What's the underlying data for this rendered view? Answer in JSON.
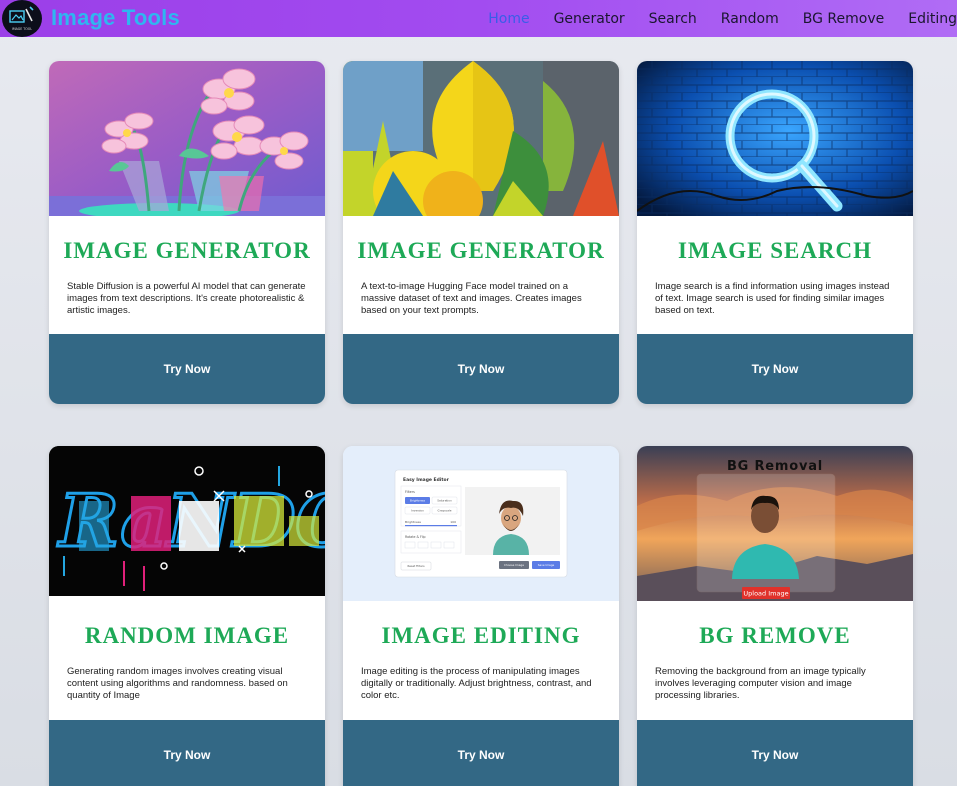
{
  "navbar": {
    "brand": "Image Tools",
    "logo_text": "IMAGE TOOL",
    "links": [
      "Home",
      "Generator",
      "Search",
      "Random",
      "BG Remove",
      "Editing"
    ]
  },
  "cards": [
    {
      "title": "IMAGE GENERATOR",
      "description": "Stable Diffusion is a powerful AI model that can generate images from text descriptions. It's create photorealistic & artistic images.",
      "button": "Try Now"
    },
    {
      "title": "IMAGE GENERATOR",
      "description": "A text-to-image Hugging Face model trained on a massive dataset of text and images. Creates images based on your text prompts.",
      "button": "Try Now"
    },
    {
      "title": "IMAGE SEARCH",
      "description": "Image search is a find information using images instead of text. Image search is used for finding similar images based on text.",
      "button": "Try Now"
    },
    {
      "title": "RANDOM IMAGE",
      "description": "Generating random images involves creating visual content using algorithms and randomness. based on quantity of Image",
      "button": "Try Now"
    },
    {
      "title": "IMAGE EDITING",
      "description": "Image editing is the process of manipulating images digitally or traditionally. Adjust brightness, contrast, and color etc.",
      "button": "Try Now"
    },
    {
      "title": "BG REMOVE",
      "description": "Removing the background from an image typically involves leveraging computer vision and image processing libraries.",
      "button": "Try Now"
    }
  ],
  "images": {
    "random_art_text": "RaNDOM.",
    "editor": {
      "title": "Easy Image Editor",
      "filters_label": "Filters",
      "filters": [
        "Brightness",
        "Saturation",
        "Inversion",
        "Grayscale"
      ],
      "slider_label": "Brightness",
      "slider_value": "100",
      "rotate_label": "Rotate & Flip",
      "reset_label": "Reset Filters",
      "choose_label": "Choose Image",
      "save_label": "Save Image"
    },
    "bg_removal": {
      "heading": "BG Removal",
      "upload_label": "Upload Image"
    }
  },
  "colors": {
    "navbar_start": "#9b3fe8",
    "navbar_end": "#b06cf5",
    "brand": "#2fb6f0",
    "nav_active": "#3a5de8",
    "card_title": "#1ea957",
    "button_bg": "#336885"
  }
}
